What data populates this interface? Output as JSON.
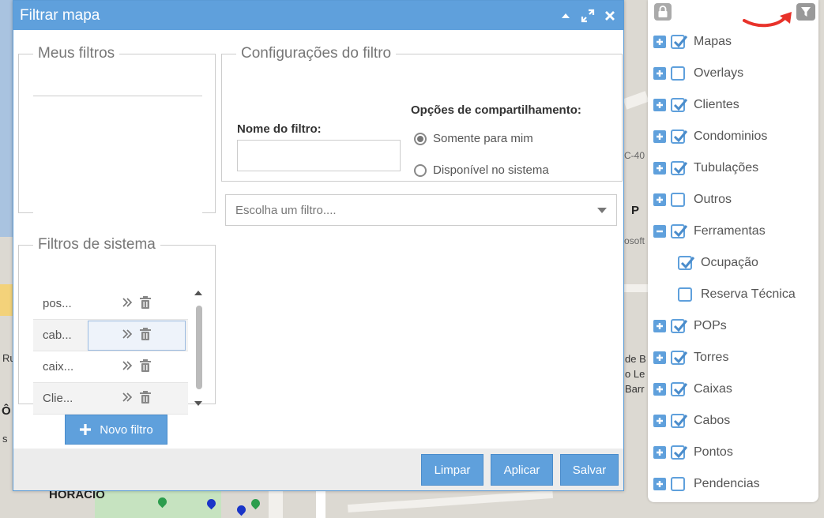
{
  "dialog": {
    "title": "Filtrar mapa",
    "meus_filtros_legend": "Meus filtros",
    "filtros_sistema_legend": "Filtros de sistema",
    "config_legend": "Configurações do filtro",
    "nome_label": "Nome do filtro:",
    "nome_value": "",
    "share_label": "Opções de compartilhamento:",
    "radio_only_me": "Somente para mim",
    "radio_system": "Disponível no sistema",
    "radio_selected": "only_me",
    "select_placeholder": "Escolha um filtro....",
    "novo_filtro": "Novo filtro",
    "btn_limpar": "Limpar",
    "btn_aplicar": "Aplicar",
    "btn_salvar": "Salvar",
    "system_filters": [
      {
        "name": "pos..."
      },
      {
        "name": "cab..."
      },
      {
        "name": "caix..."
      },
      {
        "name": "Clie..."
      }
    ]
  },
  "layers": [
    {
      "label": "Mapas",
      "expander": "plus",
      "checked": true
    },
    {
      "label": "Overlays",
      "expander": "plus",
      "checked": false
    },
    {
      "label": "Clientes",
      "expander": "plus",
      "checked": true
    },
    {
      "label": "Condominios",
      "expander": "plus",
      "checked": true
    },
    {
      "label": "Tubulações",
      "expander": "plus",
      "checked": true
    },
    {
      "label": "Outros",
      "expander": "plus",
      "checked": false
    },
    {
      "label": "Ferramentas",
      "expander": "minus",
      "checked": true
    },
    {
      "label": "Ocupação",
      "expander": "none",
      "checked": true,
      "child": true
    },
    {
      "label": "Reserva Técnica",
      "expander": "none",
      "checked": false,
      "child": true
    },
    {
      "label": "POPs",
      "expander": "plus",
      "checked": true
    },
    {
      "label": "Torres",
      "expander": "plus",
      "checked": true
    },
    {
      "label": "Caixas",
      "expander": "plus",
      "checked": true
    },
    {
      "label": "Cabos",
      "expander": "plus",
      "checked": true
    },
    {
      "label": "Pontos",
      "expander": "plus",
      "checked": true
    },
    {
      "label": "Pendencias",
      "expander": "plus",
      "checked": false
    }
  ],
  "map_labels": {
    "horacio": "HORÁCIO",
    "p": "P",
    "ru": "Ru",
    "o_hat": "Ô",
    "de_b": "de B",
    "o_le": "o Le",
    "barr": "Barr",
    "sc40": "C-40",
    "soft": "osoft",
    "s": "s"
  },
  "colors": {
    "accent": "#5fa0dc",
    "arrow": "#e8322a"
  }
}
